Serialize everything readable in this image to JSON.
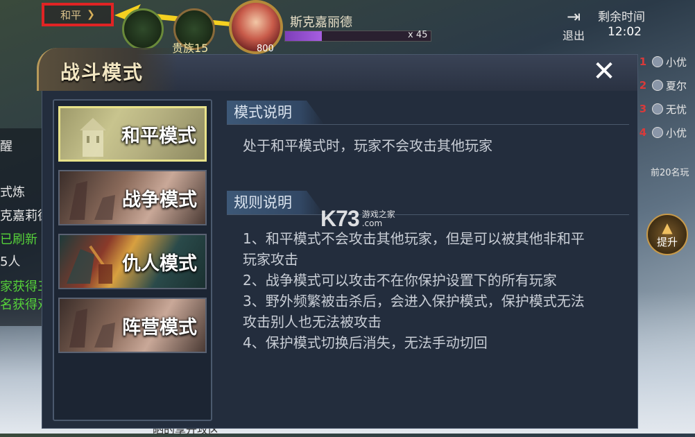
{
  "hud": {
    "mode_badge": "和平",
    "noble_label": "贵族15",
    "avatar_level": "800",
    "hero_name": "斯克嘉丽德",
    "hero_bar_fill": 0.25,
    "hero_count": "x 45",
    "exit_label": "退出",
    "timer_label": "剩余时间",
    "timer_value": "12:02",
    "ranking": [
      {
        "num": "1",
        "name": "小优"
      },
      {
        "num": "2",
        "name": "夏尔"
      },
      {
        "num": "3",
        "name": "无忧"
      },
      {
        "num": "4",
        "name": "小优"
      }
    ],
    "ranking_footer": "前20名玩",
    "upgrade_label": "提升",
    "left_texts": [
      "醒",
      "式炼",
      "克嘉莉德",
      "已刷新",
      "5人",
      "家获得三",
      "名获得双"
    ],
    "bottom_partial": "晒的享升攻区"
  },
  "dialog": {
    "title": "战斗模式",
    "modes": [
      {
        "label": "和平模式"
      },
      {
        "label": "战争模式"
      },
      {
        "label": "仇人模式"
      },
      {
        "label": "阵营模式"
      }
    ],
    "selected_mode": "和平模式",
    "mode_desc_title": "模式说明",
    "mode_desc_text": "处于和平模式时，玩家不会攻击其他玩家",
    "rules_title": "规则说明",
    "rules_lines": [
      "1、和平模式不会攻击其他玩家，但是可以被其他非和平",
      "玩家攻击",
      "2、战争模式可以攻击不在你保护设置下的所有玩家",
      "3、野外频繁被击杀后，会进入保护模式，保护模式无法",
      "攻击别人也无法被攻击",
      "4、保护模式切换后消失，无法手动切回"
    ]
  },
  "watermark": {
    "logo": "K73",
    "line1": "游戏之家",
    "line2": ".com"
  },
  "colors": {
    "selected_border": "#e8e28a",
    "badge_border": "#e02424",
    "arrow": "#f5d020"
  }
}
